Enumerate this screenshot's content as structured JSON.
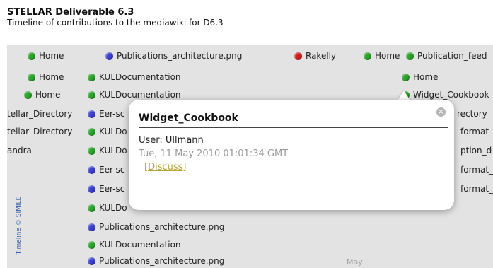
{
  "header": {
    "title": "STELLAR Deliverable 6.3",
    "subtitle": "Timeline of contributions to the mediawiki for D6.3"
  },
  "timeline": {
    "credit": "Timeline © SIMILE",
    "month_label": "May",
    "events": [
      {
        "label": "Home",
        "color": "green"
      },
      {
        "label": "Publications_architecture.png",
        "color": "blue"
      },
      {
        "label": "Rakelly",
        "color": "red"
      },
      {
        "label": "Home",
        "color": "green"
      },
      {
        "label": "Publication_feed",
        "color": "green"
      },
      {
        "label": "Home",
        "color": "green"
      },
      {
        "label": "KULDocumentation",
        "color": "green"
      },
      {
        "label": "Home",
        "color": "green"
      },
      {
        "label": "Home",
        "color": "green"
      },
      {
        "label": "KULDocumentation",
        "color": "green"
      },
      {
        "label": "Widget_Cookbook",
        "color": "green"
      },
      {
        "label": "tellar_Directory",
        "color": "none"
      },
      {
        "label": "Eer-sc",
        "color": "blue"
      },
      {
        "label": "rectory",
        "color": "none"
      },
      {
        "label": "tellar_Directory",
        "color": "none"
      },
      {
        "label": "KULDo",
        "color": "green"
      },
      {
        "label": "format_",
        "color": "none"
      },
      {
        "label": "andra",
        "color": "none"
      },
      {
        "label": "KULDo",
        "color": "green"
      },
      {
        "label": "ption_d",
        "color": "none"
      },
      {
        "label": "Eer-sc",
        "color": "blue"
      },
      {
        "label": "format_",
        "color": "none"
      },
      {
        "label": "Eer-sc",
        "color": "blue"
      },
      {
        "label": "format_",
        "color": "none"
      },
      {
        "label": "KULDo",
        "color": "green"
      },
      {
        "label": "Publications_architecture.png",
        "color": "blue"
      },
      {
        "label": "KULDocumentation",
        "color": "green"
      },
      {
        "label": "Publications_architecture.png",
        "color": "blue"
      }
    ]
  },
  "popup": {
    "title": "Widget_Cookbook",
    "user": "User: Ullmann",
    "date": "Tue, 11 May 2010 01:01:34 GMT",
    "discuss": "[Discuss]",
    "close_glyph": "×"
  },
  "colors": {
    "green": "#2aa52a",
    "blue": "#3a3fd0",
    "red": "#d21d1d"
  }
}
